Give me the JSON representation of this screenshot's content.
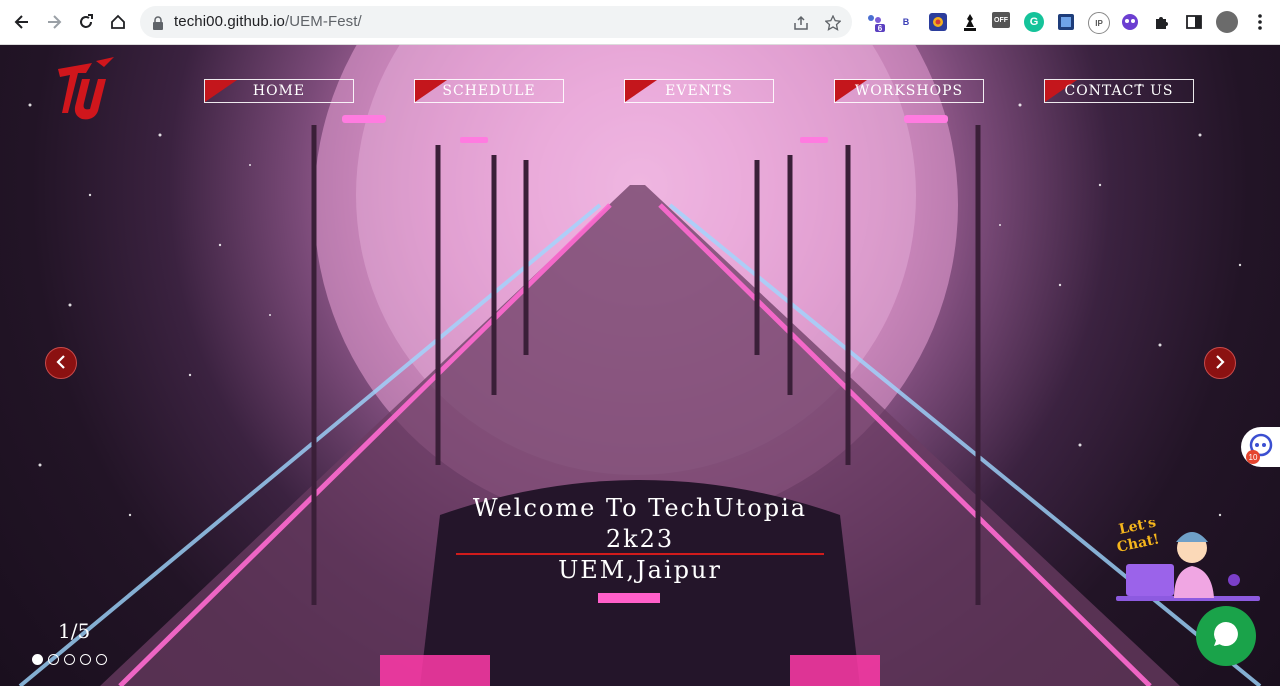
{
  "browser": {
    "url_host": "techi00.github.io",
    "url_path": "/UEM-Fest/",
    "extensions": [
      {
        "icon": "bubbles-extension-icon",
        "badge": "6"
      },
      {
        "icon": "b-extension-icon",
        "label": "B"
      },
      {
        "icon": "color-extension-icon"
      },
      {
        "icon": "chess-extension-icon"
      },
      {
        "icon": "off-extension-icon",
        "label": "OFF"
      },
      {
        "icon": "grammarly-extension-icon",
        "label": "G"
      },
      {
        "icon": "db-extension-icon"
      },
      {
        "icon": "ip-extension-icon",
        "label": "IP"
      },
      {
        "icon": "ghost-extension-icon"
      },
      {
        "icon": "puzzle-extension-icon"
      },
      {
        "icon": "sidepanel-icon"
      },
      {
        "icon": "profile-avatar"
      }
    ]
  },
  "site": {
    "menu": [
      "HOME",
      "SCHEDULE",
      "EVENTS",
      "WORKSHOPS",
      "CONTACT US"
    ],
    "welcome_line1": "Welcome To TechUtopia 2k23",
    "welcome_line2": "UEM,Jaipur",
    "slide_counter": "1/5",
    "slide_total": 5,
    "slide_active": 1,
    "side_badge": "10",
    "chat_sticker": "Let's Chat!"
  },
  "colors": {
    "accent": "#c4161c",
    "chat_green": "#1aa34a"
  }
}
